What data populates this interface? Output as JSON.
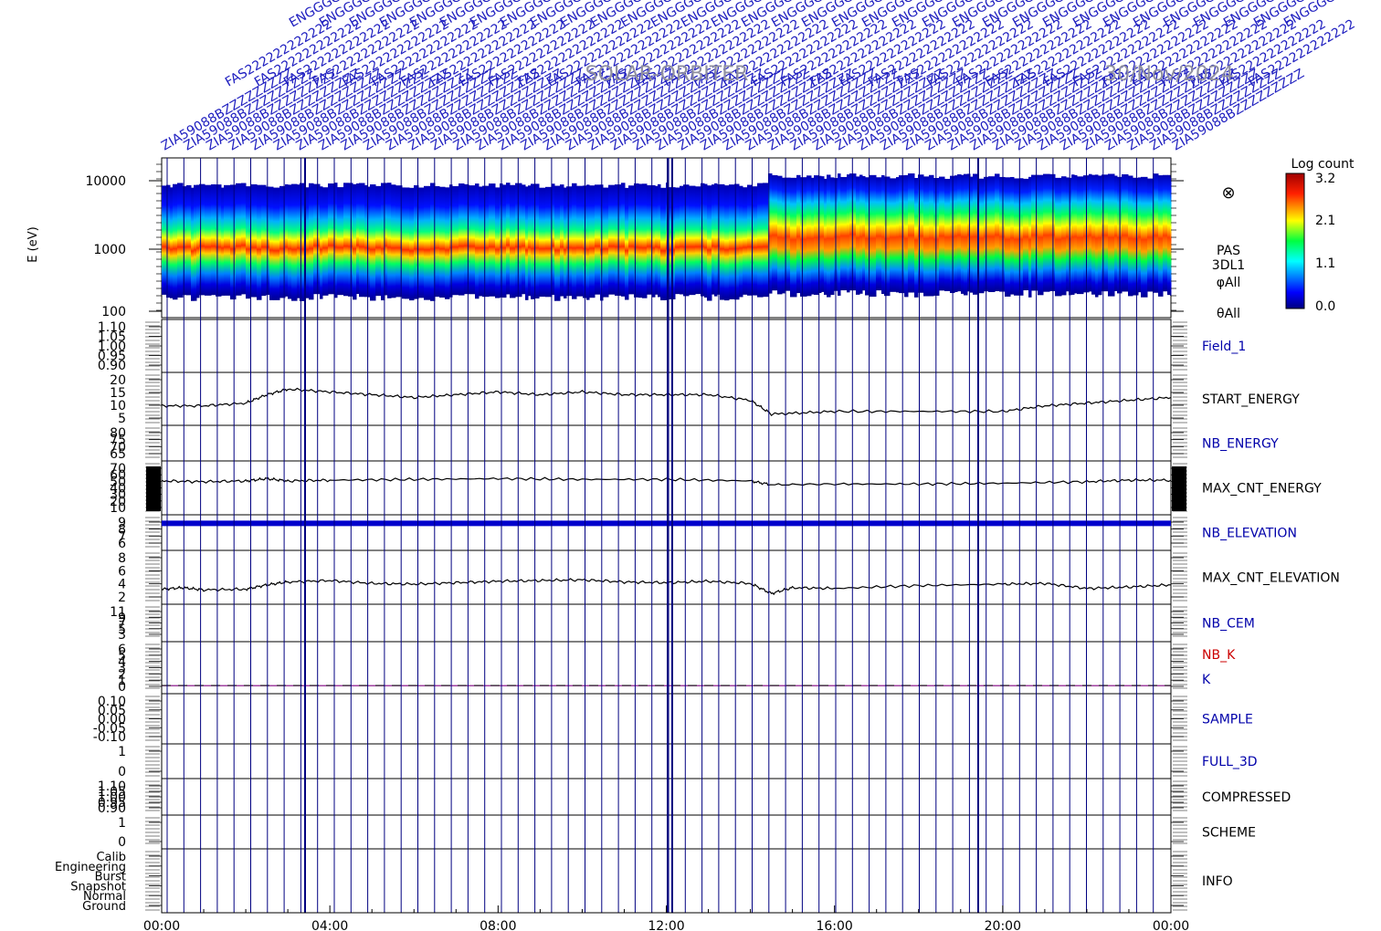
{
  "header": {
    "title": "SOLAR-ORBITER",
    "date": "30/Nov/2024"
  },
  "colorbar": {
    "title": "Log count",
    "ticks": [
      "3.2",
      "2.1",
      "1.1",
      "0.0"
    ]
  },
  "spectrogram": {
    "ylabel": "E (eV)",
    "yticks": [
      "10000",
      "1000",
      "100"
    ],
    "side_labels": [
      "PAS",
      "3DL1",
      "φAll",
      "θAll"
    ],
    "symbol": "⊗"
  },
  "colors": {
    "marker_line": "#000080",
    "header_text": "#2020c0",
    "panel_label_blue": "#0000aa",
    "panel_label_red": "#cc0000",
    "k_line": "#800080"
  },
  "chart_data": {
    "type": "line",
    "xlabel": "",
    "x_ticks": [
      "00:00",
      "04:00",
      "08:00",
      "12:00",
      "16:00",
      "20:00",
      "00:00"
    ],
    "xlim": [
      0,
      24
    ],
    "panels": [
      {
        "label": "Field_1",
        "label_color": "blue",
        "yticks": [
          "1.10",
          "1.05",
          "1.00",
          "0.95",
          "0.90"
        ]
      },
      {
        "label": "START_ENERGY",
        "label_color": "black",
        "yticks": [
          "20",
          "15",
          "10",
          "5"
        ],
        "series": {
          "x": [
            0,
            1,
            2,
            2.5,
            3,
            4,
            5,
            6,
            7,
            8,
            9,
            10,
            11,
            12,
            13,
            14,
            14.5,
            16,
            18,
            20,
            21,
            22,
            23,
            24
          ],
          "y": [
            10,
            10,
            11,
            14,
            16,
            15,
            14,
            13,
            14,
            15,
            14,
            15,
            14,
            14,
            14,
            12,
            7,
            8,
            8,
            8,
            10,
            11,
            12,
            13
          ]
        }
      },
      {
        "label": "NB_ENERGY",
        "label_color": "blue",
        "yticks": [
          "80",
          "75",
          "70",
          "65"
        ]
      },
      {
        "label": "MAX_CNT_ENERGY",
        "label_color": "black",
        "yticks": [
          "70",
          "60",
          "50",
          "40",
          "30",
          "20",
          "10"
        ],
        "series": {
          "x": [
            0,
            1,
            2,
            2.5,
            3,
            4,
            6,
            8,
            10,
            12,
            14,
            14.5,
            16,
            18,
            20,
            22,
            23,
            24
          ],
          "y": [
            49,
            48,
            49,
            52,
            49,
            50,
            51,
            52,
            51,
            51,
            49,
            44,
            45,
            45,
            46,
            48,
            50,
            50
          ]
        }
      },
      {
        "label": "NB_ELEVATION",
        "label_color": "blue",
        "yticks": [
          "9",
          "8",
          "7",
          "6"
        ],
        "series": {
          "x": [
            0,
            24
          ],
          "y": [
            8.8,
            8.8
          ]
        }
      },
      {
        "label": "MAX_CNT_ELEVATION",
        "label_color": "black",
        "yticks": [
          "8",
          "6",
          "4",
          "2"
        ],
        "series": {
          "x": [
            0,
            0.5,
            1,
            2,
            2.5,
            3,
            4,
            5,
            6,
            7,
            8,
            9,
            10,
            11,
            12,
            13,
            14,
            14.5,
            15,
            16,
            18,
            20,
            21,
            22,
            23,
            24
          ],
          "y": [
            3.6,
            3.8,
            3.5,
            3.6,
            4.2,
            4.6,
            4.8,
            4.4,
            4.3,
            4.5,
            4.7,
            4.8,
            4.9,
            4.6,
            4.5,
            4.7,
            4.4,
            3.0,
            3.8,
            3.7,
            4.1,
            4.3,
            4.4,
            3.7,
            3.9,
            4.2
          ]
        }
      },
      {
        "label": "NB_CEM",
        "label_color": "blue",
        "yticks": [
          "11",
          "9",
          "7",
          "5",
          "3"
        ]
      },
      {
        "label": "NB_K",
        "label_color": "red",
        "yticks": [
          "6",
          "5",
          "4",
          "3",
          "2",
          "1",
          "0"
        ],
        "second_label": "K",
        "second_label_color": "blue",
        "series": {
          "x": [
            0,
            24
          ],
          "y": [
            1,
            1
          ]
        }
      },
      {
        "label": "SAMPLE",
        "label_color": "blue",
        "yticks": [
          "0.10",
          "0.05",
          "0.00",
          "-0.05",
          "-0.10"
        ]
      },
      {
        "label": "FULL_3D",
        "label_color": "blue",
        "yticks": [
          "1",
          "0"
        ]
      },
      {
        "label": "COMPRESSED",
        "label_color": "black",
        "yticks": [
          "1.10",
          "1.05",
          "1.00",
          "0.95",
          "0.90"
        ]
      },
      {
        "label": "SCHEME",
        "label_color": "black",
        "yticks": [
          "1",
          "0"
        ]
      },
      {
        "label": "INFO",
        "label_color": "black",
        "yticks": [
          "Calib",
          "Engineering",
          "Burst",
          "Snapshot",
          "Normal",
          "Ground"
        ]
      }
    ],
    "event_labels": [
      "ZIA59088B",
      "FAS22",
      "ENG"
    ]
  }
}
